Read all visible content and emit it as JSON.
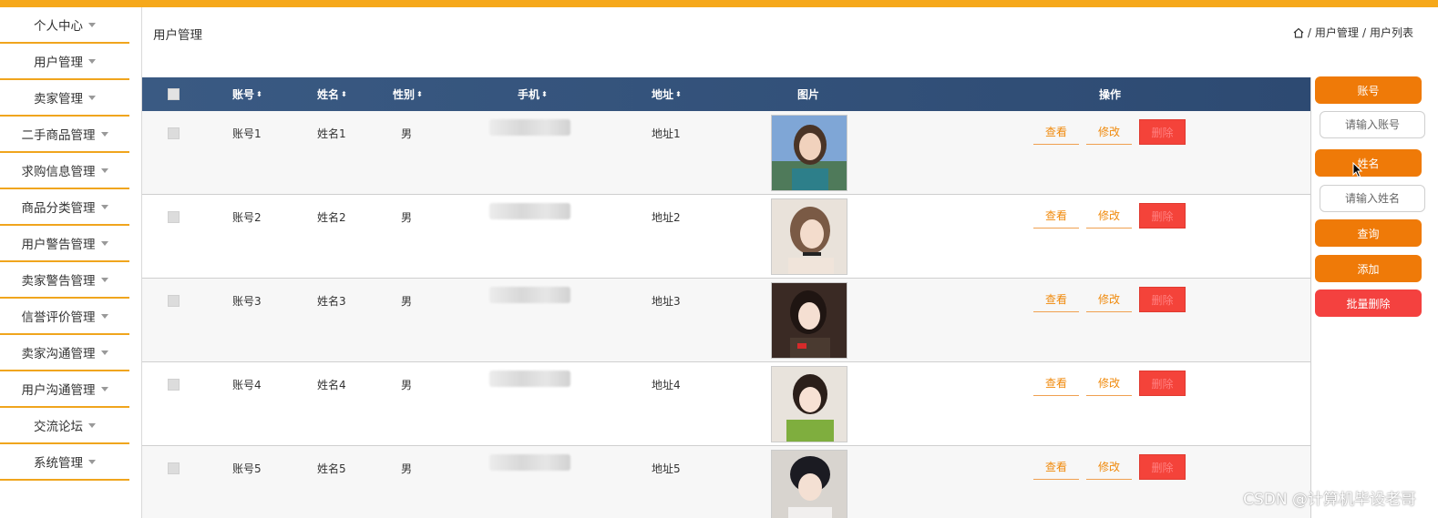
{
  "sidebar": {
    "items": [
      {
        "label": "个人中心"
      },
      {
        "label": "用户管理"
      },
      {
        "label": "卖家管理"
      },
      {
        "label": "二手商品管理"
      },
      {
        "label": "求购信息管理"
      },
      {
        "label": "商品分类管理"
      },
      {
        "label": "用户警告管理"
      },
      {
        "label": "卖家警告管理"
      },
      {
        "label": "信誉评价管理"
      },
      {
        "label": "卖家沟通管理"
      },
      {
        "label": "用户沟通管理"
      },
      {
        "label": "交流论坛"
      },
      {
        "label": "系统管理"
      }
    ]
  },
  "header": {
    "title": "用户管理",
    "breadcrumb": [
      "用户管理",
      "用户列表"
    ],
    "separator": "/"
  },
  "table": {
    "columns": {
      "account": "账号",
      "name": "姓名",
      "gender": "性别",
      "phone": "手机",
      "address": "地址",
      "image": "图片",
      "actions": "操作"
    },
    "sort_glyph": "⬍",
    "rows": [
      {
        "account": "账号1",
        "name": "姓名1",
        "gender": "男",
        "address": "地址1",
        "view": "查看",
        "edit": "修改",
        "delete": "删除"
      },
      {
        "account": "账号2",
        "name": "姓名2",
        "gender": "男",
        "address": "地址2",
        "view": "查看",
        "edit": "修改",
        "delete": "删除"
      },
      {
        "account": "账号3",
        "name": "姓名3",
        "gender": "男",
        "address": "地址3",
        "view": "查看",
        "edit": "修改",
        "delete": "删除"
      },
      {
        "account": "账号4",
        "name": "姓名4",
        "gender": "男",
        "address": "地址4",
        "view": "查看",
        "edit": "修改",
        "delete": "删除"
      },
      {
        "account": "账号5",
        "name": "姓名5",
        "gender": "男",
        "address": "地址5",
        "view": "查看",
        "edit": "修改",
        "delete": "删除"
      }
    ]
  },
  "search_panel": {
    "account_label": "账号",
    "account_placeholder": "请输入账号",
    "name_label": "姓名",
    "name_placeholder": "请输入姓名",
    "query_button": "查询",
    "add_button": "添加",
    "batch_delete_button": "批量删除"
  },
  "watermark": "CSDN @计算机毕设老哥",
  "colors": {
    "accent": "#f6a81a",
    "button_orange": "#ef7a08",
    "danger": "#f4413f",
    "table_header": "#34527a"
  }
}
